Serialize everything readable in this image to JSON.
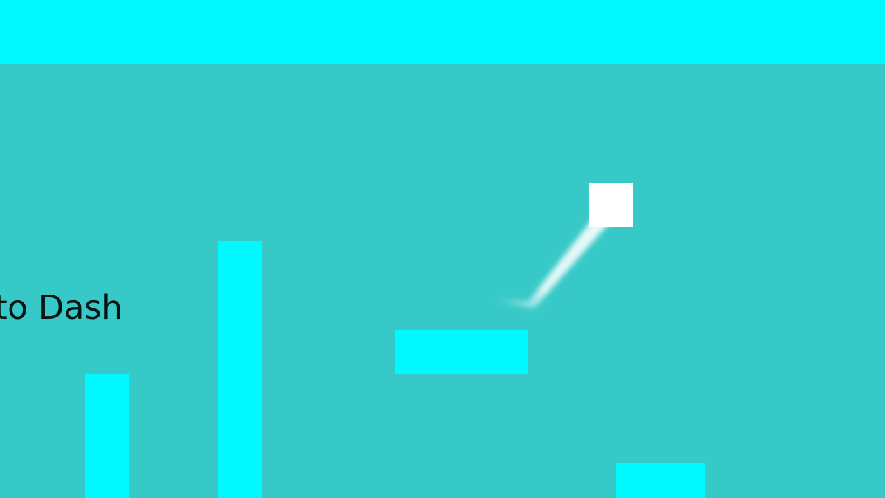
{
  "game": {
    "hint_text": "to Dash"
  },
  "colors": {
    "background": "#37c9c8",
    "platform": "#00f8ff",
    "player": "#ffffff",
    "trail": "#e6fffc",
    "text": "#0a1414"
  },
  "entities": {
    "player": {
      "shape": "square"
    },
    "trail": {
      "shape": "dash-streak"
    }
  }
}
